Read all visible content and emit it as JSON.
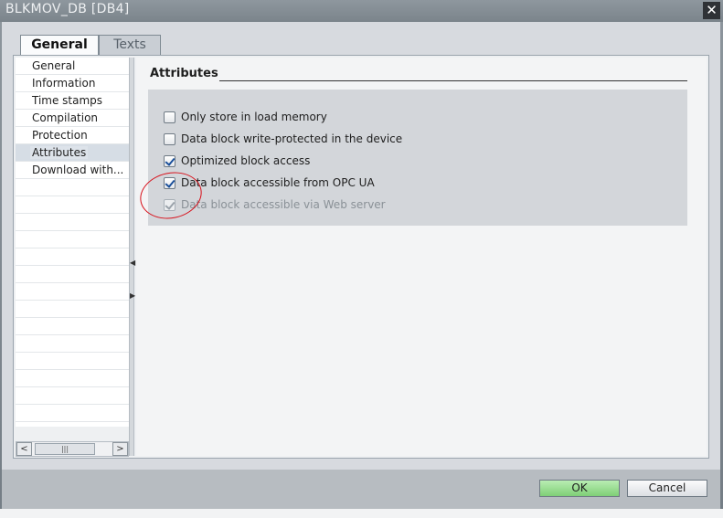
{
  "window": {
    "title": "BLKMOV_DB [DB4]",
    "close_glyph": "✕"
  },
  "tabs": [
    {
      "label": "General",
      "active": true
    },
    {
      "label": "Texts",
      "active": false
    }
  ],
  "nav": {
    "items": [
      {
        "label": "General"
      },
      {
        "label": "Information"
      },
      {
        "label": "Time stamps"
      },
      {
        "label": "Compilation"
      },
      {
        "label": "Protection"
      },
      {
        "label": "Attributes",
        "selected": true
      },
      {
        "label": "Download with..."
      }
    ],
    "scroll_left": "<",
    "scroll_right": ">",
    "thumb_grip": "|||"
  },
  "section": {
    "title": "Attributes",
    "checkboxes": [
      {
        "label": "Only store in load memory",
        "checked": false,
        "disabled": false
      },
      {
        "label": "Data block write-protected in the device",
        "checked": false,
        "disabled": false
      },
      {
        "label": "Optimized block access",
        "checked": true,
        "disabled": false
      },
      {
        "label": "Data block accessible from OPC UA",
        "checked": true,
        "disabled": false
      },
      {
        "label": "Data block accessible via Web server",
        "checked": true,
        "disabled": true
      }
    ]
  },
  "footer": {
    "ok_label": "OK",
    "cancel_label": "Cancel"
  },
  "colors": {
    "annotation": "#d8101a",
    "ok_button": "#8fd786",
    "title_bar": "#868f96"
  }
}
